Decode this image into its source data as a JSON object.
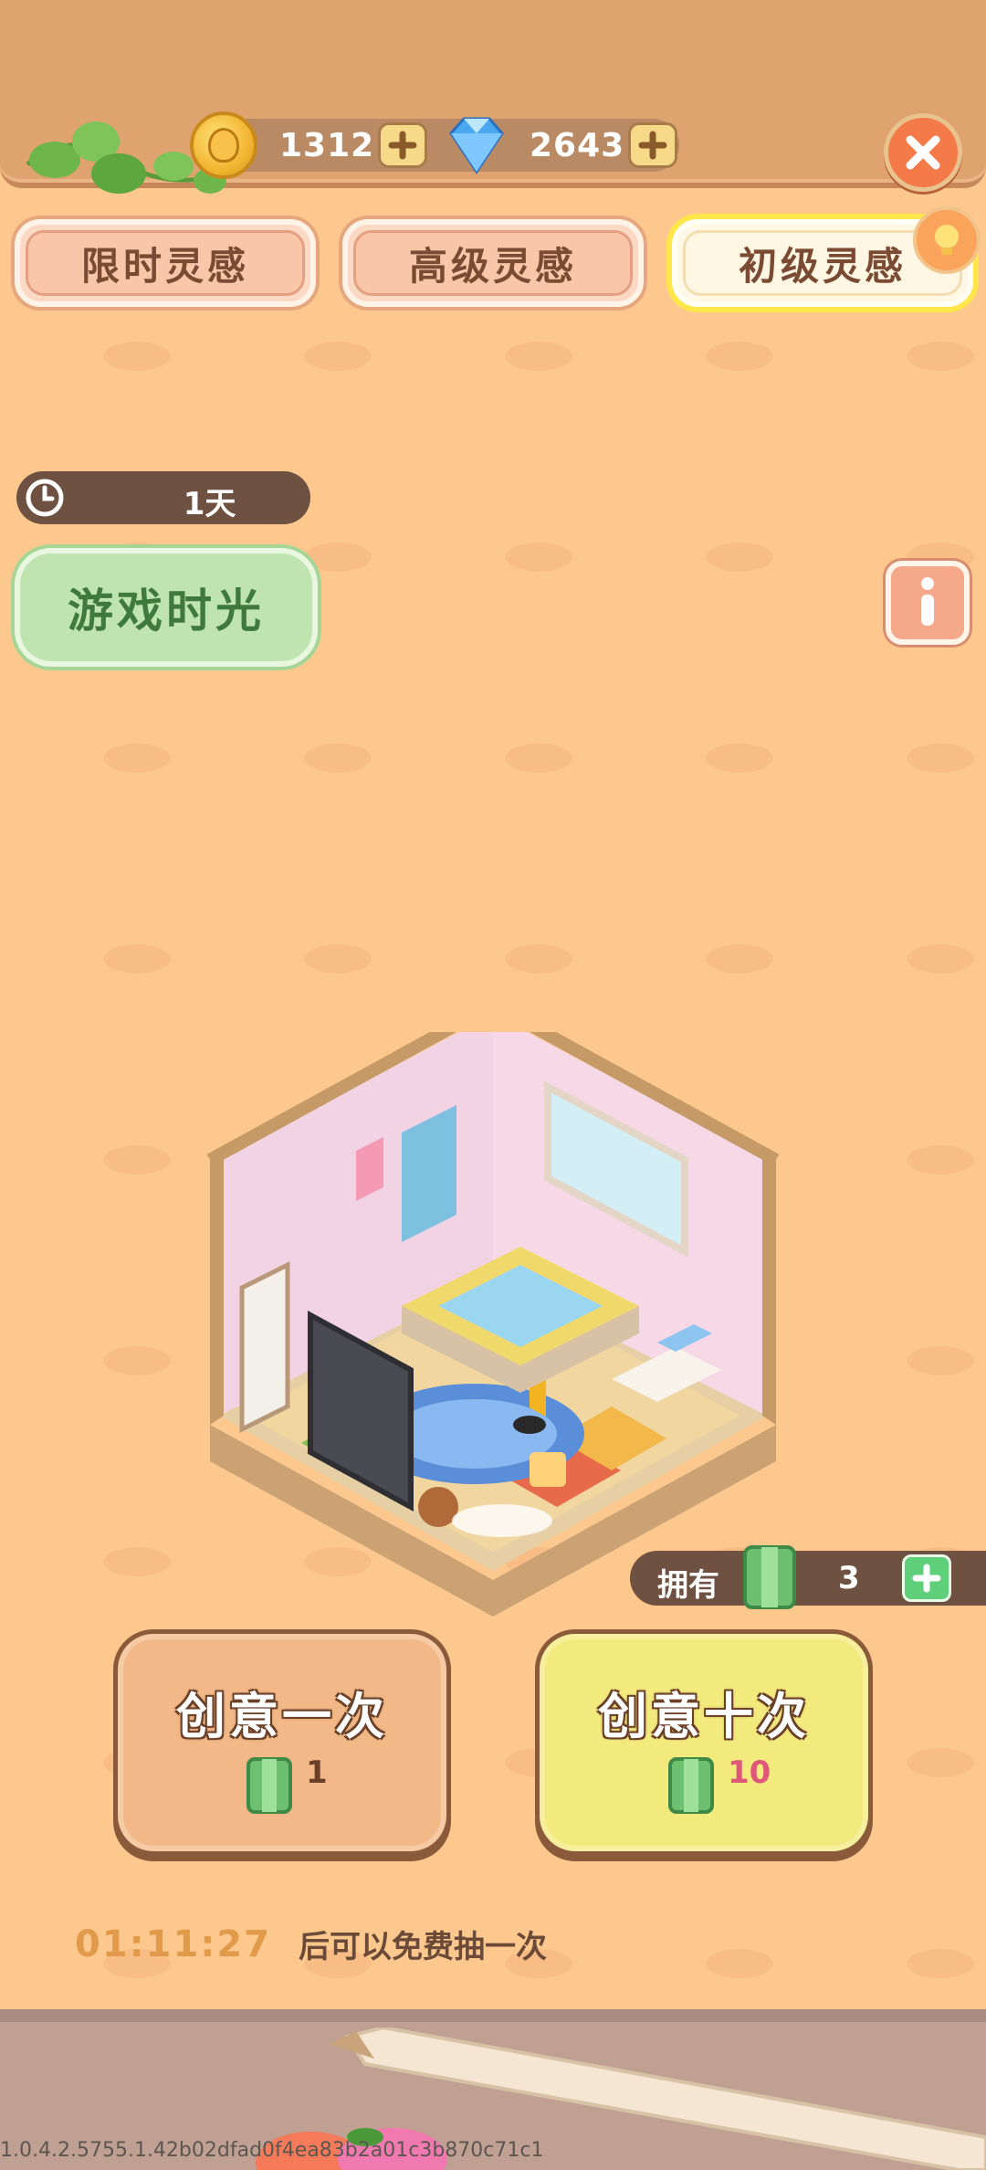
{
  "currencies": {
    "coins": "1312",
    "gems": "2643"
  },
  "tabs": [
    {
      "label": "限时灵感"
    },
    {
      "label": "高级灵感"
    },
    {
      "label": "初级灵感"
    }
  ],
  "event": {
    "duration": "1天",
    "title": "游戏时光"
  },
  "owned": {
    "label": "拥有",
    "count": "3"
  },
  "draw": {
    "once_label": "创意一次",
    "once_cost": "1",
    "ten_label": "创意十次",
    "ten_cost": "10"
  },
  "free_draw": {
    "countdown": "01:11:27",
    "text": "后可以免费抽一次"
  },
  "version": "1.0.4.2.5755.1.42b02dfad0f4ea83b2a01c3b870c71c1",
  "colors": {
    "background": "#fcc88e",
    "active_tab_glow": "#ffe64a",
    "ten_cost_text": "#e0567a",
    "free_countdown": "#e09a4a"
  }
}
